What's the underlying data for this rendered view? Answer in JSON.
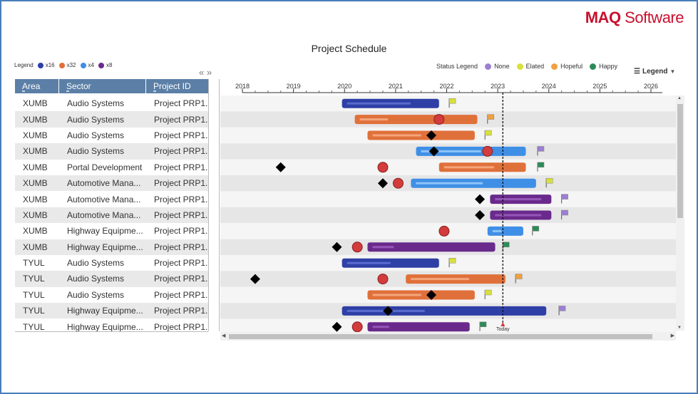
{
  "brand": {
    "name_bold": "MAQ",
    "name_rest": " Software"
  },
  "title": "Project Schedule",
  "left_legend": {
    "label": "Legend",
    "items": [
      {
        "label": "x16",
        "color": "#2e3fa6"
      },
      {
        "label": "x32",
        "color": "#e0703a"
      },
      {
        "label": "x4",
        "color": "#3f8fe6"
      },
      {
        "label": "x8",
        "color": "#6a2a8c"
      }
    ]
  },
  "status_legend": {
    "label": "Status Legend",
    "items": [
      {
        "label": "None",
        "color": "#9b7fd1"
      },
      {
        "label": "Elated",
        "color": "#d8e03a"
      },
      {
        "label": "Hopeful",
        "color": "#f0a040"
      },
      {
        "label": "Happy",
        "color": "#2e8b57"
      }
    ]
  },
  "legend_button": "Legend",
  "collapse_icons": {
    "left": "«",
    "right": "»"
  },
  "grid": {
    "columns": [
      "Area",
      "Sector",
      "Project ID"
    ],
    "rows": [
      [
        "XUMB",
        "Audio Systems",
        "Project PRP1..."
      ],
      [
        "XUMB",
        "Audio Systems",
        "Project PRP1..."
      ],
      [
        "XUMB",
        "Audio Systems",
        "Project PRP1..."
      ],
      [
        "XUMB",
        "Audio Systems",
        "Project PRP1..."
      ],
      [
        "XUMB",
        "Portal Development",
        "Project PRP1..."
      ],
      [
        "XUMB",
        "Automotive Mana...",
        "Project PRP1..."
      ],
      [
        "XUMB",
        "Automotive Mana...",
        "Project PRP1..."
      ],
      [
        "XUMB",
        "Automotive Mana...",
        "Project PRP1..."
      ],
      [
        "XUMB",
        "Highway Equipme...",
        "Project PRP1..."
      ],
      [
        "XUMB",
        "Highway Equipme...",
        "Project PRP1..."
      ],
      [
        "TYUL",
        "Audio Systems",
        "Project PRP1..."
      ],
      [
        "TYUL",
        "Audio Systems",
        "Project PRP1..."
      ],
      [
        "TYUL",
        "Audio Systems",
        "Project PRP1..."
      ],
      [
        "TYUL",
        "Highway Equipme...",
        "Project PRP1..."
      ],
      [
        "TYUL",
        "Highway Equipme...",
        "Project PRP1..."
      ]
    ]
  },
  "chart_data": {
    "type": "gantt",
    "title": "Project Schedule",
    "x_axis": {
      "min": 2018,
      "max": 2026,
      "ticks": [
        "2018",
        "2019",
        "2020",
        "2021",
        "2022",
        "2023",
        "2024",
        "2025",
        "2026"
      ]
    },
    "today": {
      "label": "Today",
      "value": 2023.1
    },
    "colors": {
      "x16": "#2e3fa6",
      "x32": "#e0703a",
      "x4": "#3f8fe6",
      "x8": "#6a2a8c",
      "milestone": "#d23c3c",
      "diamond": "#000000"
    },
    "rows": [
      {
        "bar": {
          "start": 2019.95,
          "end": 2021.85,
          "type": "x16",
          "progress": 0.73
        },
        "flag": {
          "at": 2022.05,
          "status": "Elated"
        },
        "diamonds": [],
        "circles": []
      },
      {
        "bar": {
          "start": 2020.2,
          "end": 2022.6,
          "type": "x32",
          "progress": 0.25
        },
        "flag": {
          "at": 2022.8,
          "status": "Hopeful"
        },
        "diamonds": [],
        "circles": [
          2021.85
        ]
      },
      {
        "bar": {
          "start": 2020.45,
          "end": 2022.55,
          "type": "x32",
          "progress": 0.5
        },
        "flag": {
          "at": 2022.75,
          "status": "Elated"
        },
        "diamonds": [
          2021.7
        ],
        "circles": []
      },
      {
        "bar": {
          "start": 2021.4,
          "end": 2023.55,
          "type": "x4",
          "progress": 0.6
        },
        "flag": {
          "at": 2023.78,
          "status": "None"
        },
        "diamonds": [
          2021.75
        ],
        "circles": [
          2022.8
        ]
      },
      {
        "bar": {
          "start": 2021.85,
          "end": 2023.55,
          "type": "x32",
          "progress": 0.65
        },
        "flag": {
          "at": 2023.78,
          "status": "Happy"
        },
        "diamonds": [
          2018.75
        ],
        "circles": [
          2020.75
        ]
      },
      {
        "bar": {
          "start": 2021.3,
          "end": 2023.75,
          "type": "x4",
          "progress": 0.58
        },
        "flag": {
          "at": 2023.95,
          "status": "Elated"
        },
        "diamonds": [
          2020.75
        ],
        "circles": [
          2021.05
        ]
      },
      {
        "bar": {
          "start": 2022.85,
          "end": 2024.05,
          "type": "x8",
          "progress": 0.9
        },
        "flag": {
          "at": 2024.25,
          "status": "None"
        },
        "diamonds": [
          2022.65
        ],
        "circles": []
      },
      {
        "bar": {
          "start": 2022.85,
          "end": 2024.05,
          "type": "x8",
          "progress": 0.9
        },
        "flag": {
          "at": 2024.25,
          "status": "None"
        },
        "diamonds": [
          2022.65
        ],
        "circles": []
      },
      {
        "bar": {
          "start": 2022.8,
          "end": 2023.5,
          "type": "x4",
          "progress": 0.35
        },
        "flag": {
          "at": 2023.68,
          "status": "Happy"
        },
        "diamonds": [],
        "circles": [
          2021.95
        ]
      },
      {
        "bar": {
          "start": 2020.45,
          "end": 2022.95,
          "type": "x8",
          "progress": 0.18
        },
        "flag": {
          "at": 2023.1,
          "status": "Happy"
        },
        "diamonds": [
          2019.85
        ],
        "circles": [
          2020.25
        ]
      },
      {
        "bar": {
          "start": 2019.95,
          "end": 2021.85,
          "type": "x16",
          "progress": 0.5
        },
        "flag": {
          "at": 2022.05,
          "status": "Elated"
        },
        "diamonds": [],
        "circles": []
      },
      {
        "bar": {
          "start": 2021.2,
          "end": 2023.15,
          "type": "x32",
          "progress": 0.65
        },
        "flag": {
          "at": 2023.35,
          "status": "Hopeful"
        },
        "diamonds": [
          2018.25
        ],
        "circles": [
          2020.75
        ]
      },
      {
        "bar": {
          "start": 2020.45,
          "end": 2022.55,
          "type": "x32",
          "progress": 0.5
        },
        "flag": {
          "at": 2022.75,
          "status": "Elated"
        },
        "diamonds": [
          2021.7
        ],
        "circles": []
      },
      {
        "bar": {
          "start": 2019.95,
          "end": 2023.95,
          "type": "x16",
          "progress": 0.4
        },
        "flag": {
          "at": 2024.2,
          "status": "None"
        },
        "diamonds": [
          2020.85
        ],
        "circles": []
      },
      {
        "bar": {
          "start": 2020.45,
          "end": 2022.45,
          "type": "x8",
          "progress": 0.18
        },
        "flag": {
          "at": 2022.65,
          "status": "Happy"
        },
        "diamonds": [
          2019.85
        ],
        "circles": [
          2020.25
        ]
      }
    ]
  }
}
